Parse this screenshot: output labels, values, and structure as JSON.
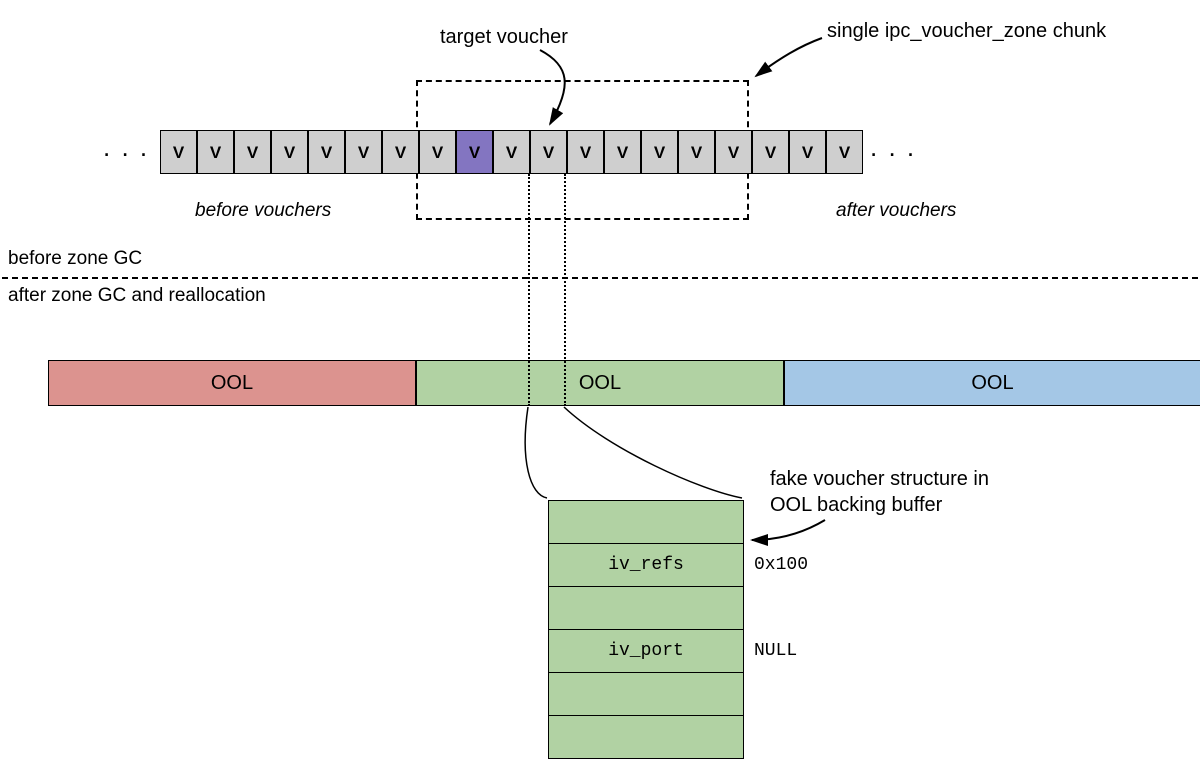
{
  "labels": {
    "target_voucher": "target voucher",
    "chunk": "single ipc_voucher_zone chunk",
    "before_vouchers": "before vouchers",
    "after_vouchers": "after vouchers",
    "before_gc": "before zone GC",
    "after_gc": "after zone GC and reallocation",
    "fake_struct": "fake voucher structure in OOL backing buffer",
    "ellipsis_left": ". . .",
    "ellipsis_right": ". . .",
    "v": "V"
  },
  "ool": {
    "red": "OOL",
    "green": "OOL",
    "blue": "OOL"
  },
  "struct": {
    "rows": [
      "",
      "iv_refs",
      "",
      "iv_port",
      "",
      ""
    ],
    "vals": [
      "",
      "0x100",
      "",
      "NULL",
      "",
      ""
    ]
  },
  "row": {
    "count": 19,
    "target_index": 8
  },
  "colors": {
    "grey": "#cfcfcf",
    "purple": "#8375c1",
    "red": "#dc938f",
    "green": "#b1d2a3",
    "blue": "#a4c7e6"
  }
}
